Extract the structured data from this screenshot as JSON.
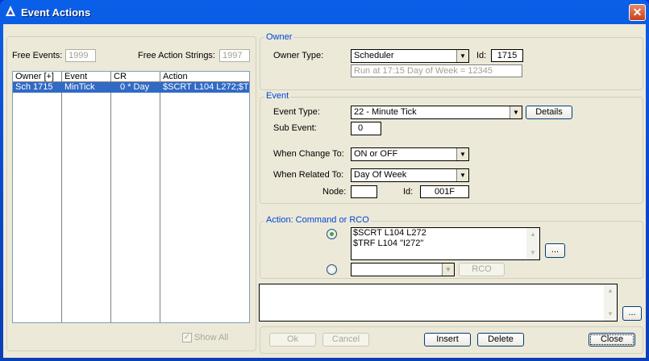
{
  "window": {
    "title": "Event Actions",
    "close": "✕"
  },
  "left": {
    "free_events_label": "Free Events:",
    "free_events": "1999",
    "free_strings_label": "Free Action Strings:",
    "free_strings": "1997",
    "columns": [
      "Owner [+]",
      "Event",
      "CR",
      "Action"
    ],
    "rows": [
      {
        "owner": "Sch 1715",
        "event": "MinTick",
        "cr": "0 * Day",
        "action": "$SCRT L104 L272;$T"
      }
    ],
    "show_all": "Show All"
  },
  "owner": {
    "group": "Owner",
    "type_label": "Owner Type:",
    "type": "Scheduler",
    "id_label": "Id:",
    "id": "1715",
    "description": "Run at 17:15 Day of Week = 12345"
  },
  "event": {
    "group": "Event",
    "type_label": "Event Type:",
    "type": "22 - Minute Tick",
    "details": "Details",
    "sub_label": "Sub Event:",
    "sub": "0",
    "change_label": "When Change To:",
    "change": "ON or OFF",
    "related_label": "When Related To:",
    "related": "Day Of Week",
    "node_label": "Node:",
    "node": "",
    "id_label": "Id:",
    "id": "001F"
  },
  "action": {
    "group": "Action: Command or RCO",
    "command_lines": [
      "$SCRT L104 L272",
      "$TRF L104 \"I272\""
    ],
    "ellipsis": "...",
    "rco": "RCO",
    "rco_value": ""
  },
  "comment": {
    "value": "",
    "ellipsis": "..."
  },
  "buttons": {
    "ok": "Ok",
    "cancel": "Cancel",
    "insert": "Insert",
    "delete": "Delete",
    "close": "Close"
  }
}
